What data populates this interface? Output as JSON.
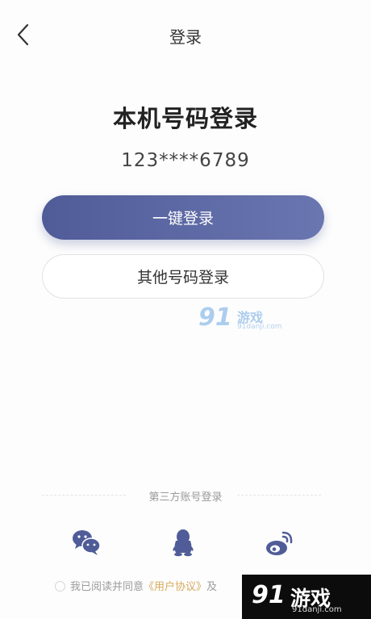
{
  "nav": {
    "title": "登录"
  },
  "login": {
    "heading": "本机号码登录",
    "phone_masked": "123****6789",
    "one_click_label": "一键登录",
    "other_number_label": "其他号码登录"
  },
  "watermark": {
    "number": "91",
    "text": "游戏",
    "url": "91danji.com"
  },
  "third_party": {
    "label": "第三方账号登录",
    "providers": [
      {
        "name": "wechat",
        "icon": "wechat-icon"
      },
      {
        "name": "qq",
        "icon": "qq-icon"
      },
      {
        "name": "weibo",
        "icon": "weibo-icon"
      }
    ]
  },
  "agreement": {
    "prefix": "我已阅读并同意",
    "link_text": "《用户协议》",
    "suffix": "及"
  },
  "corner_brand": {
    "number": "91",
    "text": "游戏",
    "url": "91danji.com"
  },
  "colors": {
    "primary": "#5865a2",
    "agreement_link": "#d7aa5c",
    "social_icon": "#4f5c98",
    "watermark": "#9fc5ec"
  }
}
